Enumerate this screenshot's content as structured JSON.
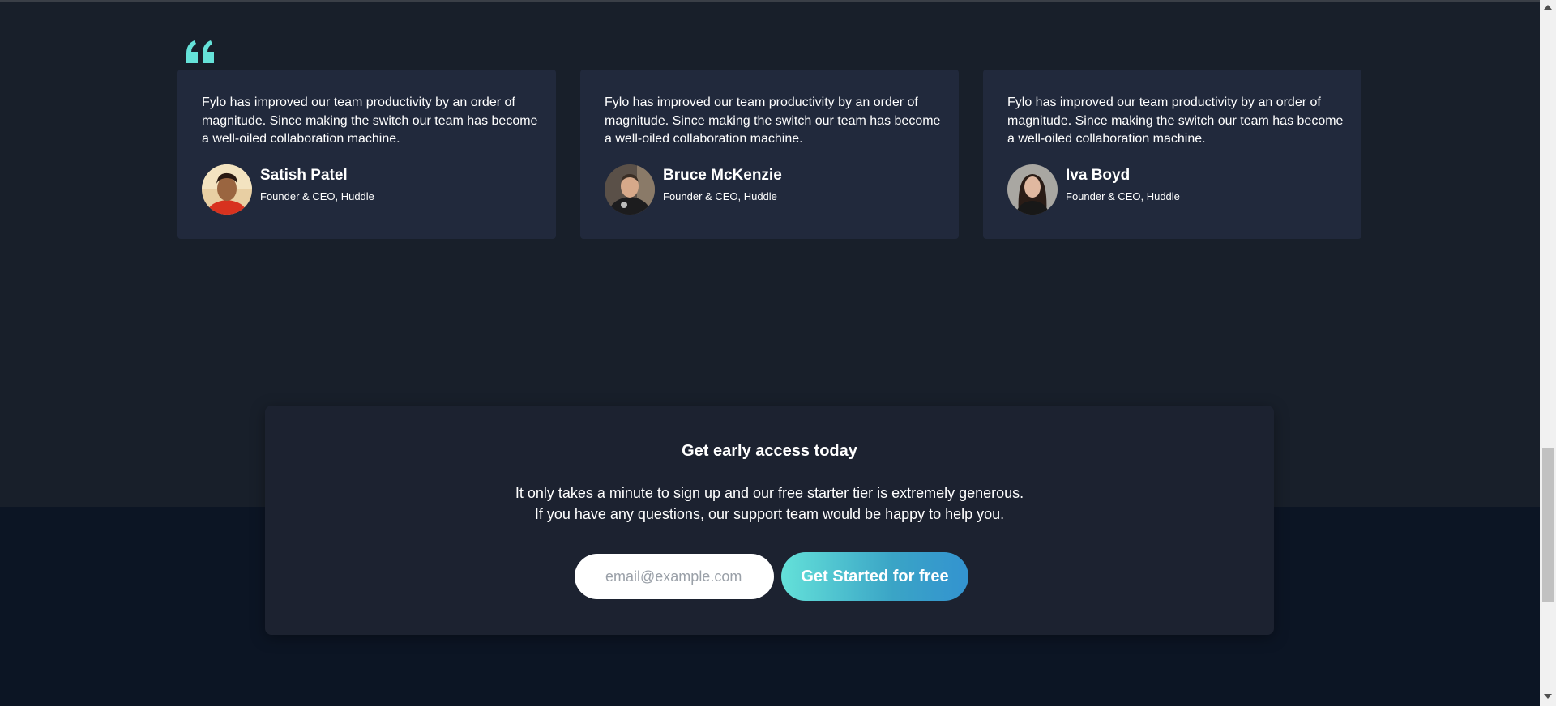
{
  "colors": {
    "accent": "#65e2d9",
    "background_upper": "#181f2a",
    "background_lower": "#0c1524",
    "card": "#21293c",
    "cta_box": "#1c2230"
  },
  "testimonials": [
    {
      "quote": "Fylo has improved our team productivity by an order of magnitude. Since making the switch our team has become a well-oiled collaboration machine.",
      "name": "Satish Patel",
      "role": "Founder & CEO, Huddle",
      "avatar": "satish-patel-avatar"
    },
    {
      "quote": "Fylo has improved our team productivity by an order of magnitude. Since making the switch our team has become a well-oiled collaboration machine.",
      "name": "Bruce McKenzie",
      "role": "Founder & CEO, Huddle",
      "avatar": "bruce-mckenzie-avatar"
    },
    {
      "quote": "Fylo has improved our team productivity by an order of magnitude. Since making the switch our team has become a well-oiled collaboration machine.",
      "name": "Iva Boyd",
      "role": "Founder & CEO, Huddle",
      "avatar": "iva-boyd-avatar"
    }
  ],
  "cta": {
    "title": "Get early access today",
    "description_line1": "It only takes a minute to sign up and our free starter tier is extremely generous.",
    "description_line2": "If you have any questions, our support team would be happy to help you.",
    "email_placeholder": "email@example.com",
    "button_label": "Get Started for free"
  }
}
